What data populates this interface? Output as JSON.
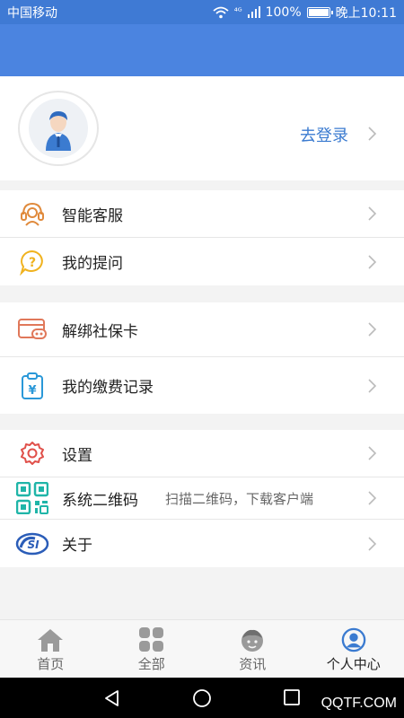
{
  "status_bar": {
    "carrier": "中国移动",
    "signal": "⁴ᴳ",
    "battery": "100%",
    "time": "晚上10:11",
    "battery_level": 1.0
  },
  "profile": {
    "login_text": "去登录"
  },
  "sections": [
    [
      {
        "label": "智能客服",
        "icon": "headset-icon"
      },
      {
        "label": "我的提问",
        "icon": "question-bubble-icon"
      }
    ],
    [
      {
        "label": "解绑社保卡",
        "icon": "card-icon"
      },
      {
        "label": "我的缴费记录",
        "icon": "yuan-clipboard-icon"
      }
    ],
    [
      {
        "label": "设置",
        "icon": "gear-icon"
      },
      {
        "label": "系统二维码",
        "sub": "扫描二维码，下载客户端",
        "icon": "qr-code-icon"
      },
      {
        "label": "关于",
        "icon": "si-logo-icon"
      }
    ]
  ],
  "tabs": [
    {
      "label": "首页",
      "icon": "home-icon"
    },
    {
      "label": "全部",
      "icon": "grid-icon"
    },
    {
      "label": "资讯",
      "icon": "news-face-icon"
    },
    {
      "label": "个人中心",
      "icon": "user-circle-icon",
      "active": true
    }
  ],
  "watermark": "QQTF.COM",
  "colors": {
    "header": "#4b84e0",
    "accent": "#3b7bd0"
  }
}
